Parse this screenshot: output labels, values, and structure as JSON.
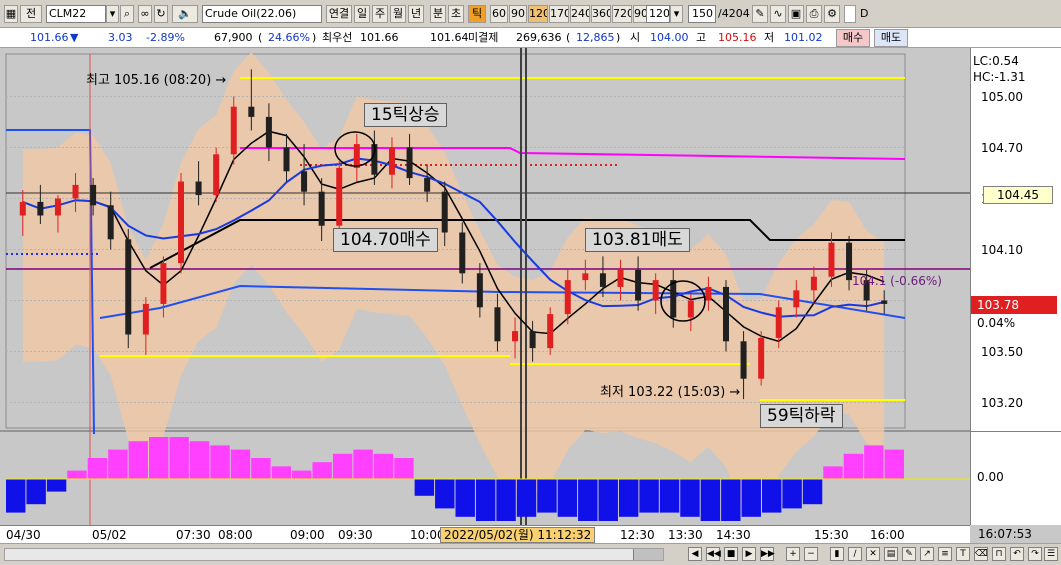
{
  "toolbar": {
    "type_label": "전",
    "symbol": "CLM22",
    "product": "Crude Oil(22.06)",
    "modes": [
      "연결",
      "일",
      "주",
      "월",
      "년",
      "분",
      "초",
      "틱"
    ],
    "active_mode": "틱",
    "intervals": [
      "60",
      "90",
      "120",
      "170",
      "240",
      "360",
      "720",
      "900"
    ],
    "active_interval": "120",
    "interval_select": "120",
    "count": "150",
    "total": "/4204",
    "checkbox_label": "D"
  },
  "quote": {
    "price": "101.66",
    "change": "3.03",
    "change_pct": "-2.89%",
    "volume": "67,900",
    "volume_pct": "24.66%",
    "best_label": "최우선",
    "best_ask": "101.66",
    "best_bid": "101.64",
    "oi_label": "미결제",
    "oi": "269,636",
    "oi_change": "12,865",
    "open_label": "시",
    "open": "104.00",
    "high_label": "고",
    "high": "105.16",
    "low_label": "저",
    "low": "101.02",
    "buy_button": "매수",
    "sell_button": "매도"
  },
  "price_axis": {
    "ticks": [
      "105.00",
      "104.70",
      "104.40",
      "104.10",
      "103.80",
      "103.50",
      "103.20"
    ],
    "tick_values": [
      105.0,
      104.7,
      104.4,
      104.1,
      103.8,
      103.5,
      103.2
    ],
    "lc": "LC:0.54",
    "hc": "HC:-1.31",
    "current_marker": "104.45",
    "last_price": "103.78",
    "last_pct": "0.04%"
  },
  "indicator_axis": {
    "zero_label": "0.00"
  },
  "time_axis": {
    "labels": [
      "04/30",
      "05/02",
      "07:30",
      "08:00",
      "09:00",
      "09:30",
      "10:00",
      "12:30",
      "13:30",
      "14:30",
      "15:30",
      "16:00"
    ],
    "cursor_label": "2022/05/02(월) 11:12:32",
    "clock": "16:07:53"
  },
  "annotations": {
    "high_marker": "최고 105.16 (08:20) →",
    "low_marker": "최저 103.22 (15:03) →",
    "rise_box": "15틱상승",
    "fall_box": "59틱하락",
    "sell1_box": "104.70매수",
    "sell2_box": "103.81매도",
    "right_pct": "104.1 (-0.66%)"
  },
  "chart_data": {
    "type": "candlestick",
    "title": "",
    "ylim": [
      103.05,
      105.25
    ],
    "candles": [
      {
        "o": 104.3,
        "h": 104.45,
        "l": 104.18,
        "c": 104.38
      },
      {
        "o": 104.38,
        "h": 104.48,
        "l": 104.25,
        "c": 104.3
      },
      {
        "o": 104.3,
        "h": 104.42,
        "l": 104.2,
        "c": 104.4
      },
      {
        "o": 104.4,
        "h": 104.55,
        "l": 104.32,
        "c": 104.48
      },
      {
        "o": 104.48,
        "h": 104.52,
        "l": 104.3,
        "c": 104.36
      },
      {
        "o": 104.36,
        "h": 104.44,
        "l": 104.1,
        "c": 104.16
      },
      {
        "o": 104.16,
        "h": 104.22,
        "l": 103.52,
        "c": 103.6
      },
      {
        "o": 103.6,
        "h": 103.82,
        "l": 103.48,
        "c": 103.78
      },
      {
        "o": 103.78,
        "h": 104.06,
        "l": 103.7,
        "c": 104.02
      },
      {
        "o": 104.02,
        "h": 104.55,
        "l": 103.96,
        "c": 104.5
      },
      {
        "o": 104.5,
        "h": 104.62,
        "l": 104.36,
        "c": 104.42
      },
      {
        "o": 104.42,
        "h": 104.7,
        "l": 104.38,
        "c": 104.66
      },
      {
        "o": 104.66,
        "h": 105.0,
        "l": 104.6,
        "c": 104.94
      },
      {
        "o": 104.94,
        "h": 105.16,
        "l": 104.8,
        "c": 104.88
      },
      {
        "o": 104.88,
        "h": 104.96,
        "l": 104.62,
        "c": 104.7
      },
      {
        "o": 104.7,
        "h": 104.78,
        "l": 104.5,
        "c": 104.56
      },
      {
        "o": 104.56,
        "h": 104.72,
        "l": 104.36,
        "c": 104.44
      },
      {
        "o": 104.44,
        "h": 104.52,
        "l": 104.15,
        "c": 104.24
      },
      {
        "o": 104.24,
        "h": 104.62,
        "l": 104.2,
        "c": 104.58
      },
      {
        "o": 104.58,
        "h": 104.78,
        "l": 104.5,
        "c": 104.72
      },
      {
        "o": 104.72,
        "h": 104.8,
        "l": 104.48,
        "c": 104.54
      },
      {
        "o": 104.54,
        "h": 104.76,
        "l": 104.46,
        "c": 104.7
      },
      {
        "o": 104.7,
        "h": 104.78,
        "l": 104.48,
        "c": 104.52
      },
      {
        "o": 104.52,
        "h": 104.6,
        "l": 104.38,
        "c": 104.44
      },
      {
        "o": 104.44,
        "h": 104.5,
        "l": 104.12,
        "c": 104.2
      },
      {
        "o": 104.2,
        "h": 104.26,
        "l": 103.9,
        "c": 103.96
      },
      {
        "o": 103.96,
        "h": 104.02,
        "l": 103.7,
        "c": 103.76
      },
      {
        "o": 103.76,
        "h": 103.84,
        "l": 103.5,
        "c": 103.56
      },
      {
        "o": 103.56,
        "h": 103.7,
        "l": 103.46,
        "c": 103.62
      },
      {
        "o": 103.62,
        "h": 103.68,
        "l": 103.44,
        "c": 103.52
      },
      {
        "o": 103.52,
        "h": 103.76,
        "l": 103.48,
        "c": 103.72
      },
      {
        "o": 103.72,
        "h": 103.98,
        "l": 103.66,
        "c": 103.92
      },
      {
        "o": 103.92,
        "h": 104.04,
        "l": 103.86,
        "c": 103.96
      },
      {
        "o": 103.96,
        "h": 104.06,
        "l": 103.82,
        "c": 103.88
      },
      {
        "o": 103.88,
        "h": 104.04,
        "l": 103.8,
        "c": 103.98
      },
      {
        "o": 103.98,
        "h": 104.06,
        "l": 103.74,
        "c": 103.8
      },
      {
        "o": 103.8,
        "h": 103.96,
        "l": 103.72,
        "c": 103.92
      },
      {
        "o": 103.92,
        "h": 103.98,
        "l": 103.64,
        "c": 103.7
      },
      {
        "o": 103.7,
        "h": 103.84,
        "l": 103.62,
        "c": 103.8
      },
      {
        "o": 103.8,
        "h": 103.94,
        "l": 103.74,
        "c": 103.88
      },
      {
        "o": 103.88,
        "h": 103.92,
        "l": 103.5,
        "c": 103.56
      },
      {
        "o": 103.56,
        "h": 103.62,
        "l": 103.22,
        "c": 103.34
      },
      {
        "o": 103.34,
        "h": 103.62,
        "l": 103.3,
        "c": 103.58
      },
      {
        "o": 103.58,
        "h": 103.8,
        "l": 103.52,
        "c": 103.76
      },
      {
        "o": 103.76,
        "h": 103.92,
        "l": 103.7,
        "c": 103.86
      },
      {
        "o": 103.86,
        "h": 104.0,
        "l": 103.78,
        "c": 103.94
      },
      {
        "o": 103.94,
        "h": 104.2,
        "l": 103.88,
        "c": 104.14
      },
      {
        "o": 104.14,
        "h": 104.18,
        "l": 103.86,
        "c": 103.92
      },
      {
        "o": 103.92,
        "h": 103.98,
        "l": 103.74,
        "c": 103.8
      },
      {
        "o": 103.8,
        "h": 103.86,
        "l": 103.72,
        "c": 103.78
      }
    ],
    "oscillator": [
      -0.8,
      -0.6,
      -0.3,
      0.2,
      0.5,
      0.7,
      0.9,
      1.0,
      1.0,
      0.9,
      0.8,
      0.7,
      0.5,
      0.3,
      0.2,
      0.4,
      0.6,
      0.7,
      0.6,
      0.5,
      -0.4,
      -0.7,
      -0.9,
      -1.0,
      -1.0,
      -0.9,
      -0.8,
      -0.9,
      -1.0,
      -1.0,
      -0.9,
      -0.8,
      -0.8,
      -0.9,
      -1.0,
      -1.0,
      -0.9,
      -0.8,
      -0.7,
      -0.6,
      0.3,
      0.6,
      0.8,
      0.7
    ]
  }
}
